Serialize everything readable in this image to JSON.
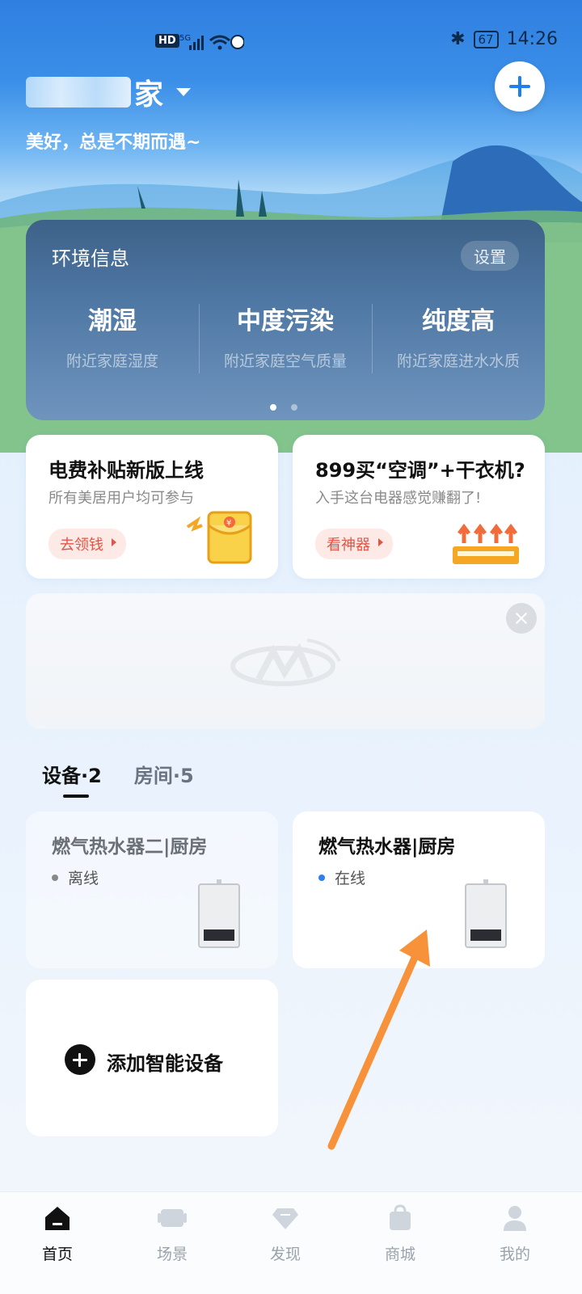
{
  "status_bar": {
    "hd": "HD",
    "network": "5G",
    "battery": "67",
    "time": "14:26"
  },
  "header": {
    "home_name": "家",
    "slogan": "美好，总是不期而遇~"
  },
  "environment": {
    "title": "环境信息",
    "settings_label": "设置",
    "items": [
      {
        "value": "潮湿",
        "desc": "附近家庭湿度"
      },
      {
        "value": "中度污染",
        "desc": "附近家庭空气质量"
      },
      {
        "value": "纯度高",
        "desc": "附近家庭进水水质"
      }
    ]
  },
  "promos": [
    {
      "title": "电费补贴新版上线",
      "subtitle": "所有美居用户均可参与",
      "button": "去领钱"
    },
    {
      "title": "899买“空调”+干衣机?",
      "subtitle": "入手这台电器感觉赚翻了!",
      "button": "看神器"
    }
  ],
  "tabs": [
    {
      "label": "设备·2"
    },
    {
      "label": "房间·5"
    }
  ],
  "devices": [
    {
      "name": "燃气热水器二|厨房",
      "status": "离线"
    },
    {
      "name": "燃气热水器|厨房",
      "status": "在线"
    }
  ],
  "add_device_label": "添加智能设备",
  "bottom_nav": [
    {
      "label": "首页",
      "icon": "home-icon"
    },
    {
      "label": "场景",
      "icon": "scene-icon"
    },
    {
      "label": "发现",
      "icon": "discover-icon"
    },
    {
      "label": "商城",
      "icon": "shop-bag-icon"
    },
    {
      "label": "我的",
      "icon": "profile-icon"
    }
  ],
  "colors": {
    "accent": "#2f7ff0",
    "promo_button_text": "#e05646",
    "annotation_arrow": "#f7923a"
  }
}
